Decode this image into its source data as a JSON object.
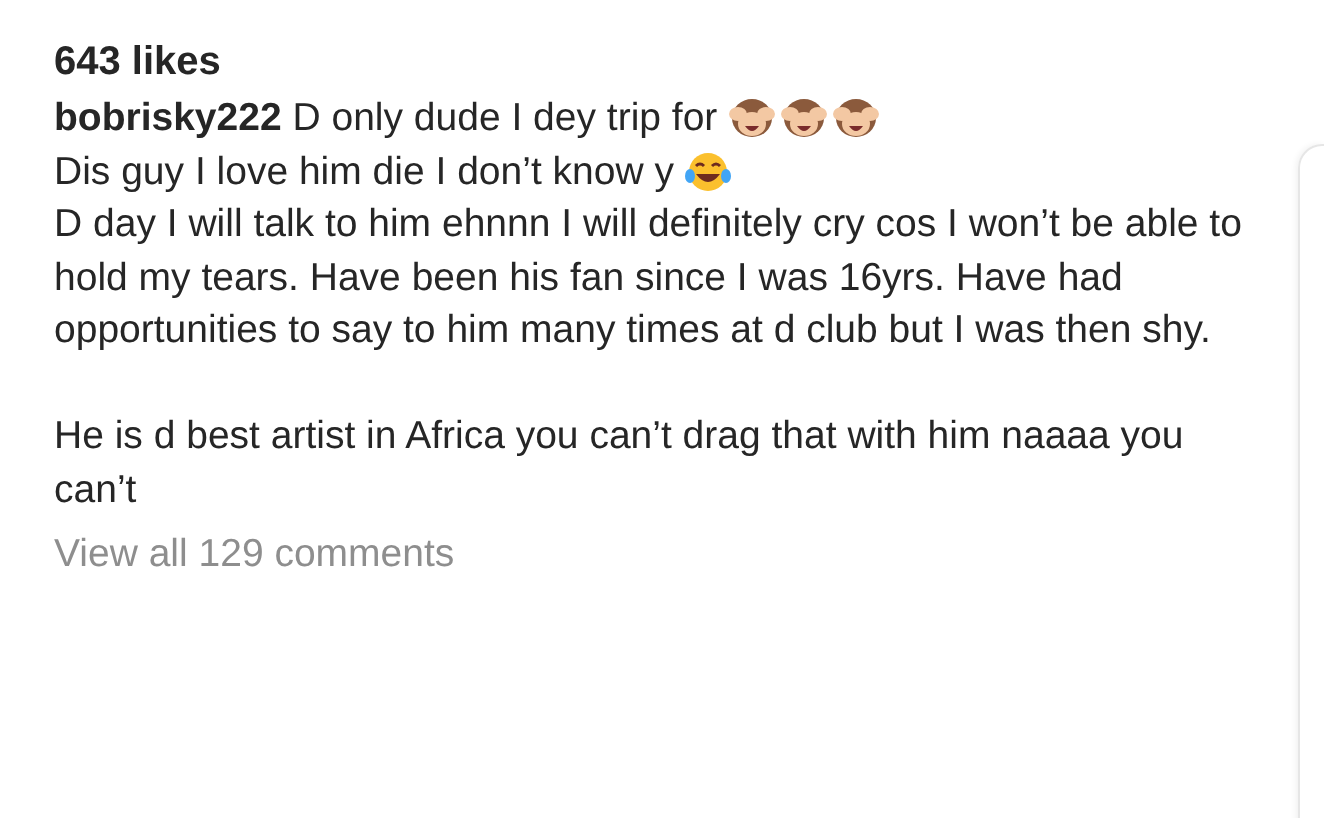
{
  "likes": "643 likes",
  "caption": [
    {
      "kind": "line",
      "text": "**bobrisky222** D only dude I dey trip for",
      "icons": [
        {
          "kind": "monkey"
        },
        {
          "kind": "monkey"
        },
        {
          "kind": "monkey"
        }
      ]
    },
    {
      "kind": "line",
      "text": "Dis guy I love him die I don’t know y",
      "icons": [
        {
          "kind": "laughing"
        }
      ]
    },
    {
      "kind": "paragraph",
      "text": "D day I will talk to him ehnnn I will definitely cry cos I won’t be able to hold my tears. Have been his fan since I was 16yrs. Have had opportunities to say to him many times at d club but I was then shy."
    },
    {
      "kind": "gap"
    },
    {
      "kind": "paragraph",
      "text": "He is d best artist in Africa you can’t drag that with him naaaa you can’t"
    }
  ],
  "view_comments": "View all 129 comments"
}
